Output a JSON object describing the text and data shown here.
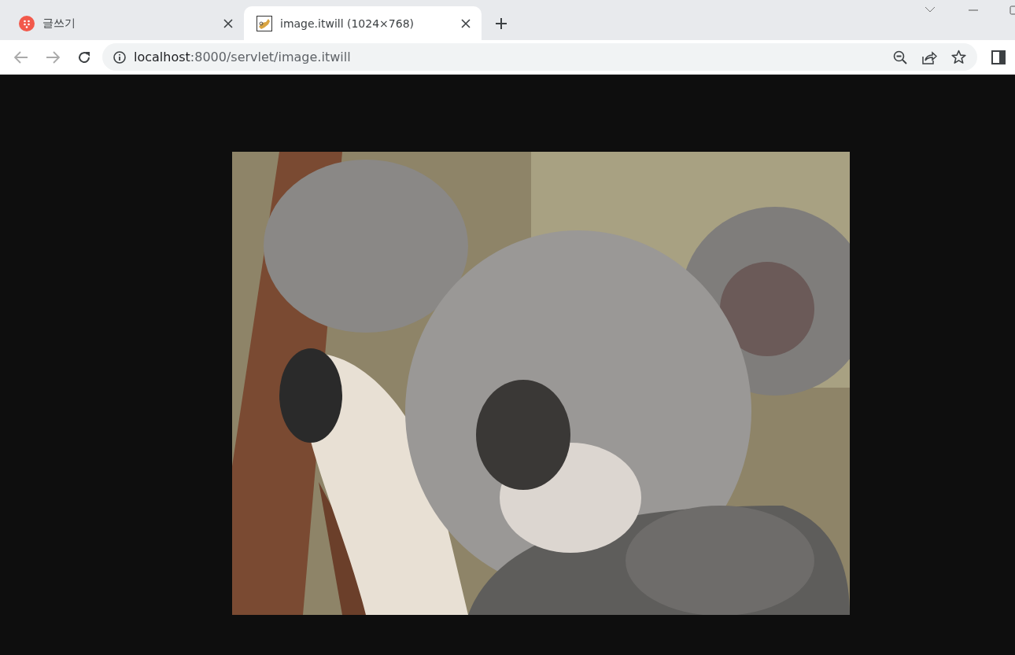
{
  "tabs": [
    {
      "title": "글쓰기",
      "kind": "dots",
      "selected": false
    },
    {
      "title": "image.itwill (1024×768)",
      "selected": true
    }
  ],
  "address": {
    "host": "localhost",
    "path": ":8000/servlet/image.itwill"
  }
}
